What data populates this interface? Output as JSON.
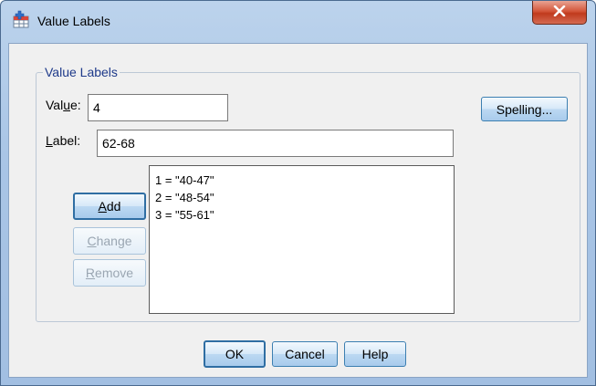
{
  "window": {
    "title": "Value Labels",
    "close_glyph": "x"
  },
  "group": {
    "legend": "Value Labels"
  },
  "value_field": {
    "label_prefix": "Val",
    "label_mnemonic": "u",
    "label_suffix": "e:",
    "value": "4"
  },
  "label_field": {
    "label_mnemonic": "L",
    "label_suffix": "abel:",
    "value": "62-68"
  },
  "list": {
    "items": [
      "1 = \"40-47\"",
      "2 = \"48-54\"",
      "3 = \"55-61\""
    ]
  },
  "buttons": {
    "add": {
      "mnemonic": "A",
      "rest": "dd"
    },
    "change": {
      "mnemonic": "C",
      "rest": "hange"
    },
    "remove": {
      "mnemonic": "R",
      "rest": "emove"
    },
    "spelling": "Spelling...",
    "ok": "OK",
    "cancel": "Cancel",
    "help": "Help"
  },
  "colors": {
    "legend_text": "#1e3a8a",
    "close_button": "#c03a1d",
    "active_button_border": "#2f6ea3"
  },
  "icons": {
    "app": "spss-table-icon",
    "close": "close-icon"
  }
}
